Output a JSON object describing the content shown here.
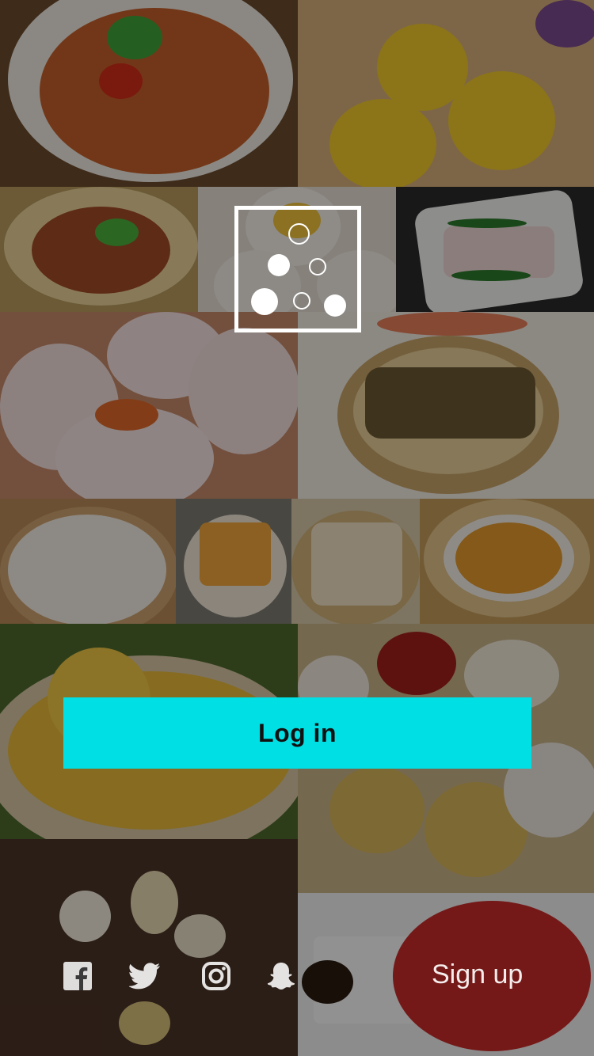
{
  "auth": {
    "login_label": "Log in",
    "signup_label": "Sign up"
  },
  "social": [
    {
      "name": "facebook-icon"
    },
    {
      "name": "twitter-icon"
    },
    {
      "name": "instagram-icon"
    },
    {
      "name": "snapchat-icon"
    }
  ],
  "colors": {
    "accent": "#00e0e4",
    "text_on_accent": "#111111",
    "overlay_text": "#ffffff"
  }
}
